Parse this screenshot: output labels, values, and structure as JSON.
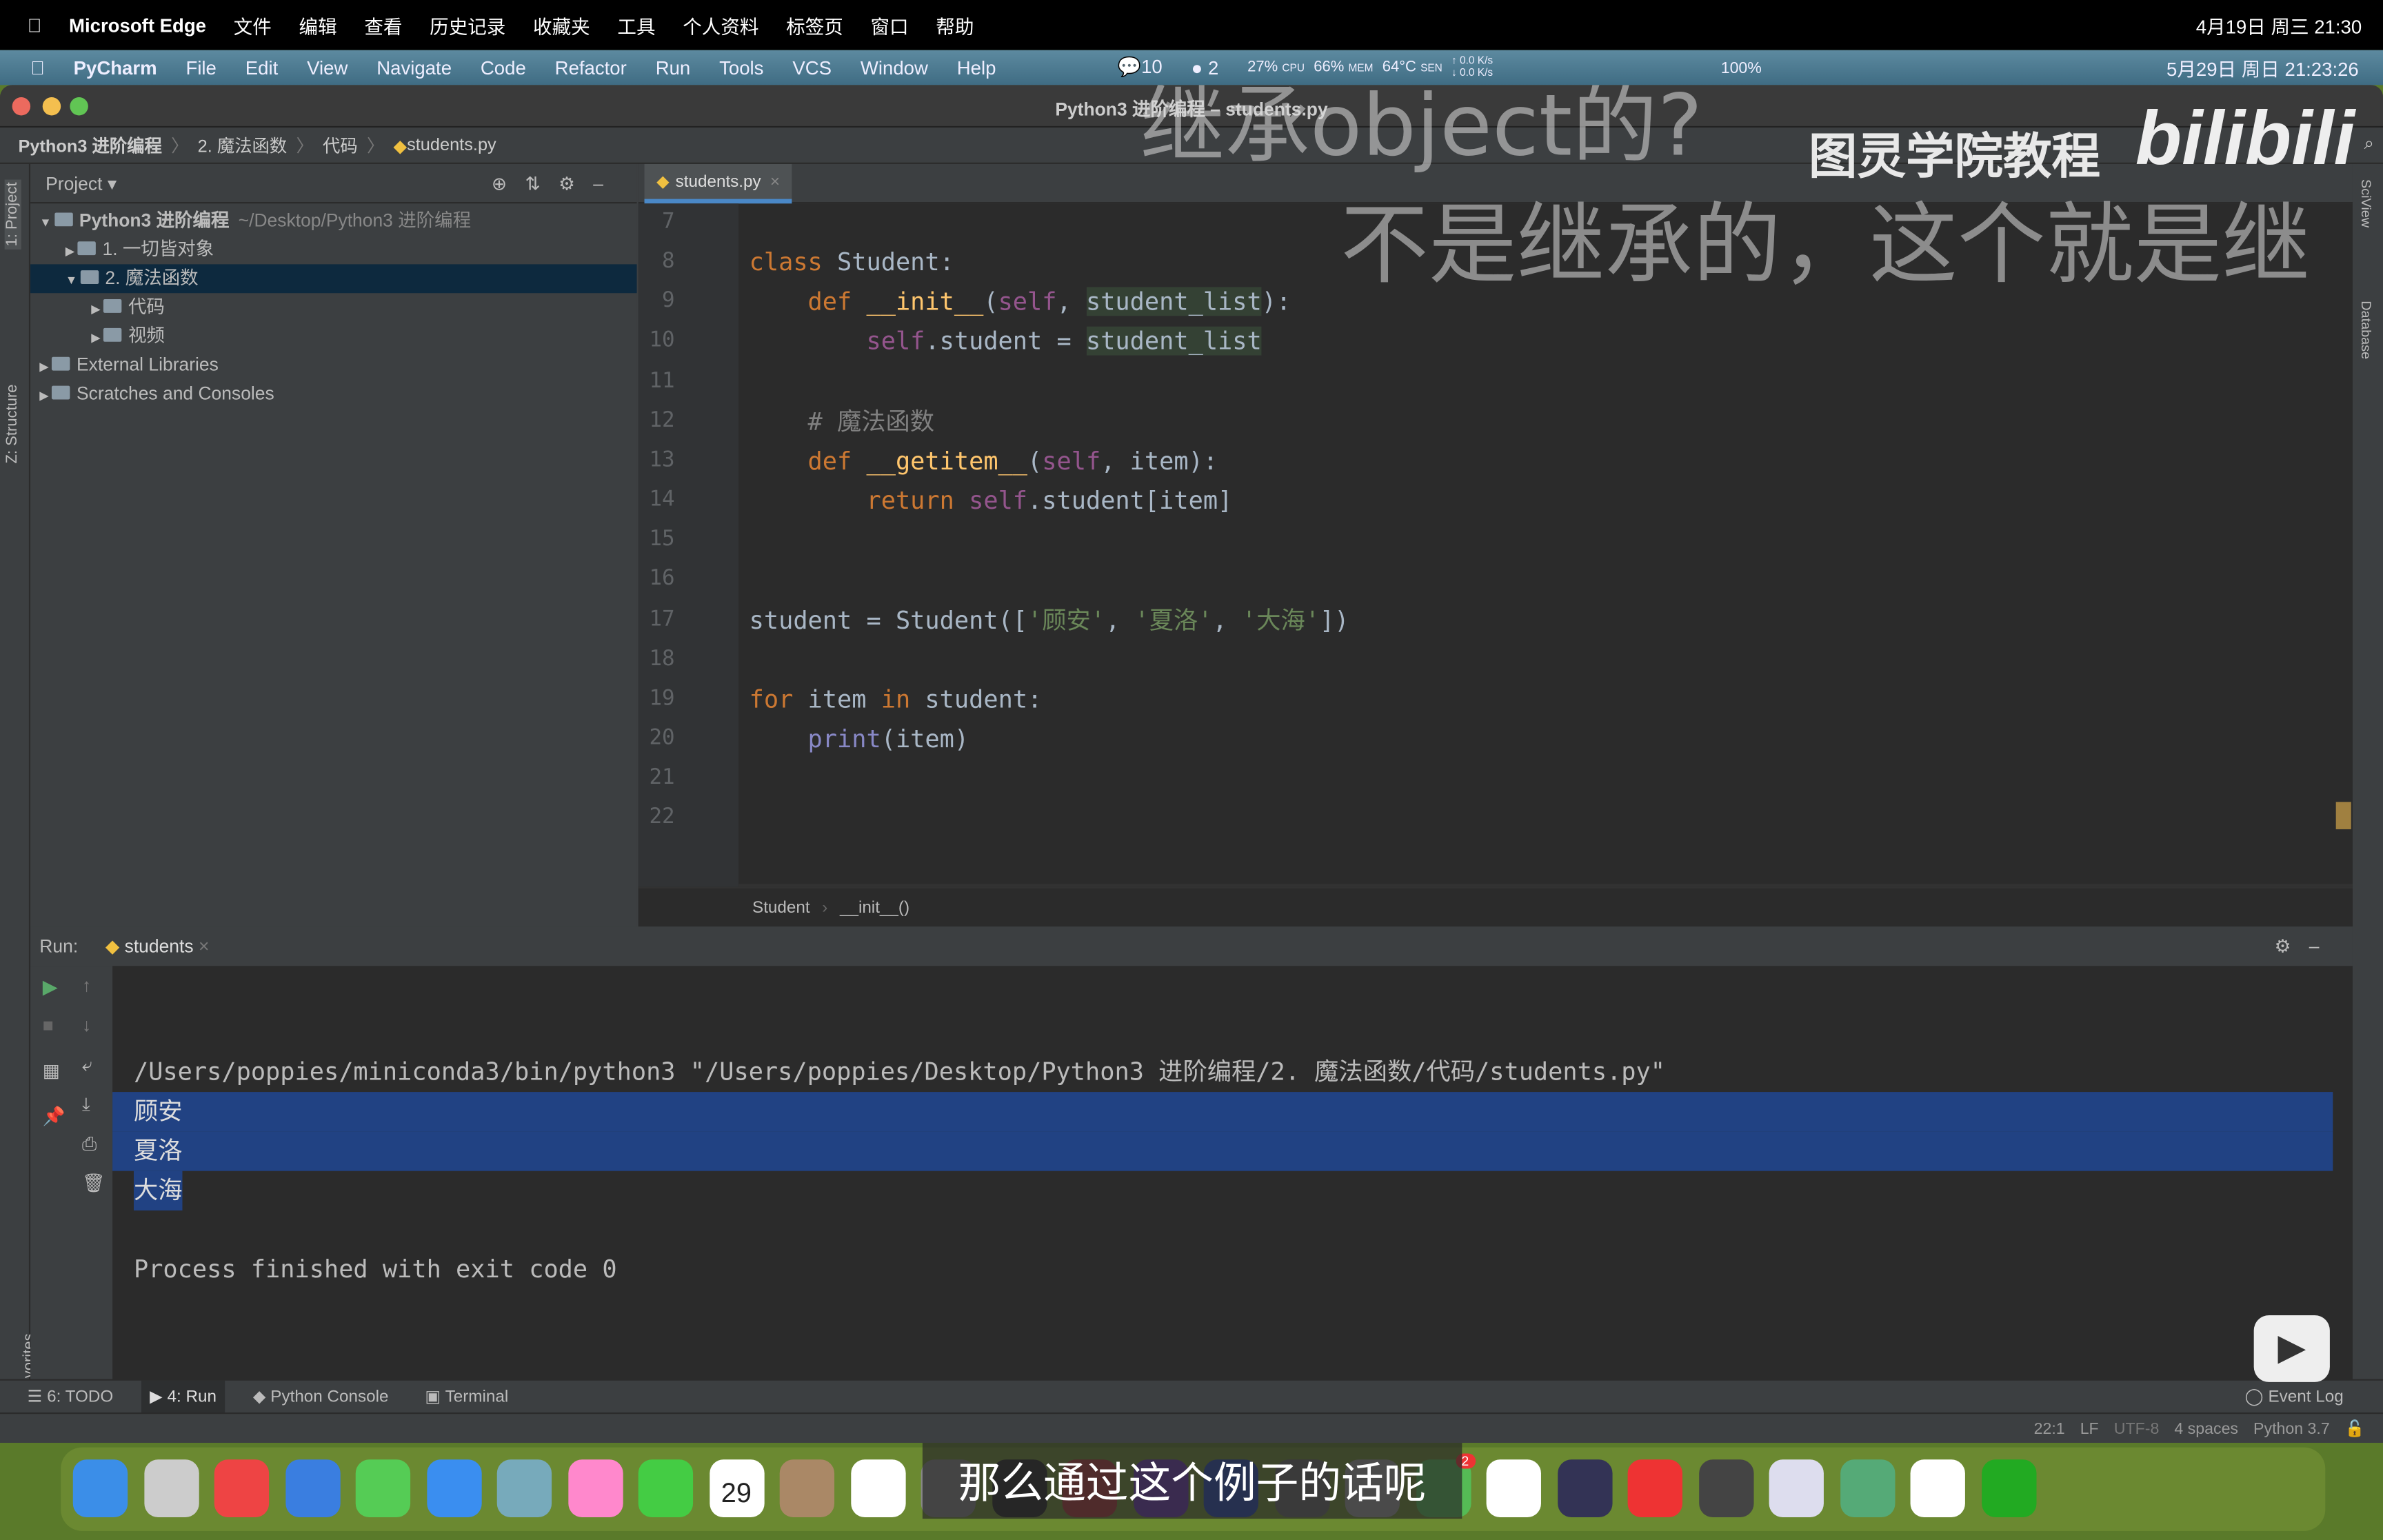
{
  "mac_menubar": {
    "app": "Microsoft Edge",
    "menus": [
      "文件",
      "编辑",
      "查看",
      "历史记录",
      "收藏夹",
      "工具",
      "个人资料",
      "标签页",
      "窗口",
      "帮助"
    ],
    "clock": "4月19日 周三 21:30"
  },
  "pycharm_menubar": {
    "app": "PyCharm",
    "menus": [
      "File",
      "Edit",
      "View",
      "Navigate",
      "Code",
      "Refactor",
      "Run",
      "Tools",
      "VCS",
      "Window",
      "Help"
    ],
    "notif1": "10",
    "notif2": "2",
    "cpu": "27%",
    "cpu_label": "CPU",
    "mem": "66%",
    "mem_label": "MEM",
    "temp": "64°C",
    "temp_label": "SEN",
    "net_up": "↑ 0.0 K/s",
    "net_down": "↓ 0.0 K/s",
    "battery": "100%",
    "clock": "5月29日 周日 21:23:26"
  },
  "window": {
    "title": "Python3 进阶编程 – students.py"
  },
  "breadcrumbs": [
    "Python3 进阶编程",
    "2. 魔法函数",
    "代码",
    "students.py"
  ],
  "side_tabs": {
    "project": "1: Project",
    "structure": "Z: Structure",
    "favorites": "2: Favorites",
    "database": "Database",
    "sciview": "SciView"
  },
  "project": {
    "header": "Project",
    "tree": [
      {
        "label": "Python3 进阶编程",
        "path": "~/Desktop/Python3 进阶编程",
        "depth": 0,
        "expanded": true
      },
      {
        "label": "1. 一切皆对象",
        "depth": 1,
        "expanded": false
      },
      {
        "label": "2. 魔法函数",
        "depth": 1,
        "expanded": true,
        "selected": true
      },
      {
        "label": "代码",
        "depth": 2,
        "expanded": false
      },
      {
        "label": "视频",
        "depth": 2,
        "expanded": false
      },
      {
        "label": "External Libraries",
        "depth": 0,
        "expanded": false
      },
      {
        "label": "Scratches and Consoles",
        "depth": 0,
        "expanded": false
      }
    ]
  },
  "editor": {
    "tab": "students.py",
    "current_line": 22,
    "lines": [
      {
        "n": "7",
        "t": []
      },
      {
        "n": "8",
        "t": [
          [
            "kw",
            "class "
          ],
          [
            "",
            "Student:"
          ]
        ]
      },
      {
        "n": "9",
        "t": [
          [
            "",
            "    "
          ],
          [
            "kw",
            "def "
          ],
          [
            "fn",
            "__init__"
          ],
          [
            "",
            "("
          ],
          [
            "self",
            "self"
          ],
          [
            "",
            ", "
          ],
          [
            "hl",
            "student_list"
          ],
          [
            "",
            "):"
          ]
        ]
      },
      {
        "n": "10",
        "t": [
          [
            "",
            "        "
          ],
          [
            "self",
            "self"
          ],
          [
            "",
            ".student = "
          ],
          [
            "hl",
            "student_list"
          ]
        ]
      },
      {
        "n": "11",
        "t": []
      },
      {
        "n": "12",
        "t": [
          [
            "",
            "    "
          ],
          [
            "cm",
            "# 魔法函数"
          ]
        ]
      },
      {
        "n": "13",
        "t": [
          [
            "",
            "    "
          ],
          [
            "kw",
            "def "
          ],
          [
            "fn",
            "__getitem__"
          ],
          [
            "",
            "("
          ],
          [
            "self",
            "self"
          ],
          [
            "",
            ", item):"
          ]
        ]
      },
      {
        "n": "14",
        "t": [
          [
            "",
            "        "
          ],
          [
            "kw",
            "return "
          ],
          [
            "self",
            "self"
          ],
          [
            "",
            ".student[item]"
          ]
        ]
      },
      {
        "n": "15",
        "t": []
      },
      {
        "n": "16",
        "t": []
      },
      {
        "n": "17",
        "t": [
          [
            "",
            "student = Student(["
          ],
          [
            "str",
            "'顾安'"
          ],
          [
            "",
            ", "
          ],
          [
            "str",
            "'夏洛'"
          ],
          [
            "",
            ", "
          ],
          [
            "str",
            "'大海'"
          ],
          [
            "",
            "])"
          ]
        ]
      },
      {
        "n": "18",
        "t": []
      },
      {
        "n": "19",
        "t": [
          [
            "kw",
            "for "
          ],
          [
            "",
            "item "
          ],
          [
            "kw",
            "in "
          ],
          [
            "",
            "student:"
          ]
        ]
      },
      {
        "n": "20",
        "t": [
          [
            "",
            "    "
          ],
          [
            "bi",
            "print"
          ],
          [
            "",
            "(item)"
          ]
        ]
      },
      {
        "n": "21",
        "t": []
      },
      {
        "n": "22",
        "t": []
      }
    ],
    "breadcrumb": [
      "Student",
      "__init__()"
    ]
  },
  "run": {
    "label": "Run:",
    "tab": "students",
    "command": "/Users/poppies/miniconda3/bin/python3 \"/Users/poppies/Desktop/Python3 进阶编程/2. 魔法函数/代码/students.py\"",
    "output": [
      "顾安",
      "夏洛",
      "大海"
    ],
    "finish": "Process finished with exit code 0"
  },
  "bottom_tabs": [
    "6: TODO",
    "4: Run",
    "Python Console",
    "Terminal"
  ],
  "event_log": "Event Log",
  "status": {
    "position": "22:1",
    "line_sep": "LF",
    "encoding": "UTF-8",
    "indent": "4 spaces",
    "interpreter": "Python 3.7"
  },
  "overlay": {
    "line1": "继承object的?",
    "line2": "不是继承的，这个就是继",
    "watermark": "图灵学院教程",
    "logo": "bilibili"
  },
  "subtitle": "那么通过这个例子的话呢",
  "dock": {
    "calendar_month": "5月",
    "calendar_day": "29",
    "wechat_badge": "2"
  },
  "colors": {
    "keyword": "#cc7832",
    "self": "#94558d",
    "function": "#ffc66d",
    "string": "#6a8759",
    "comment": "#808080",
    "selection": "#214283",
    "accent": "#4a88c7"
  }
}
